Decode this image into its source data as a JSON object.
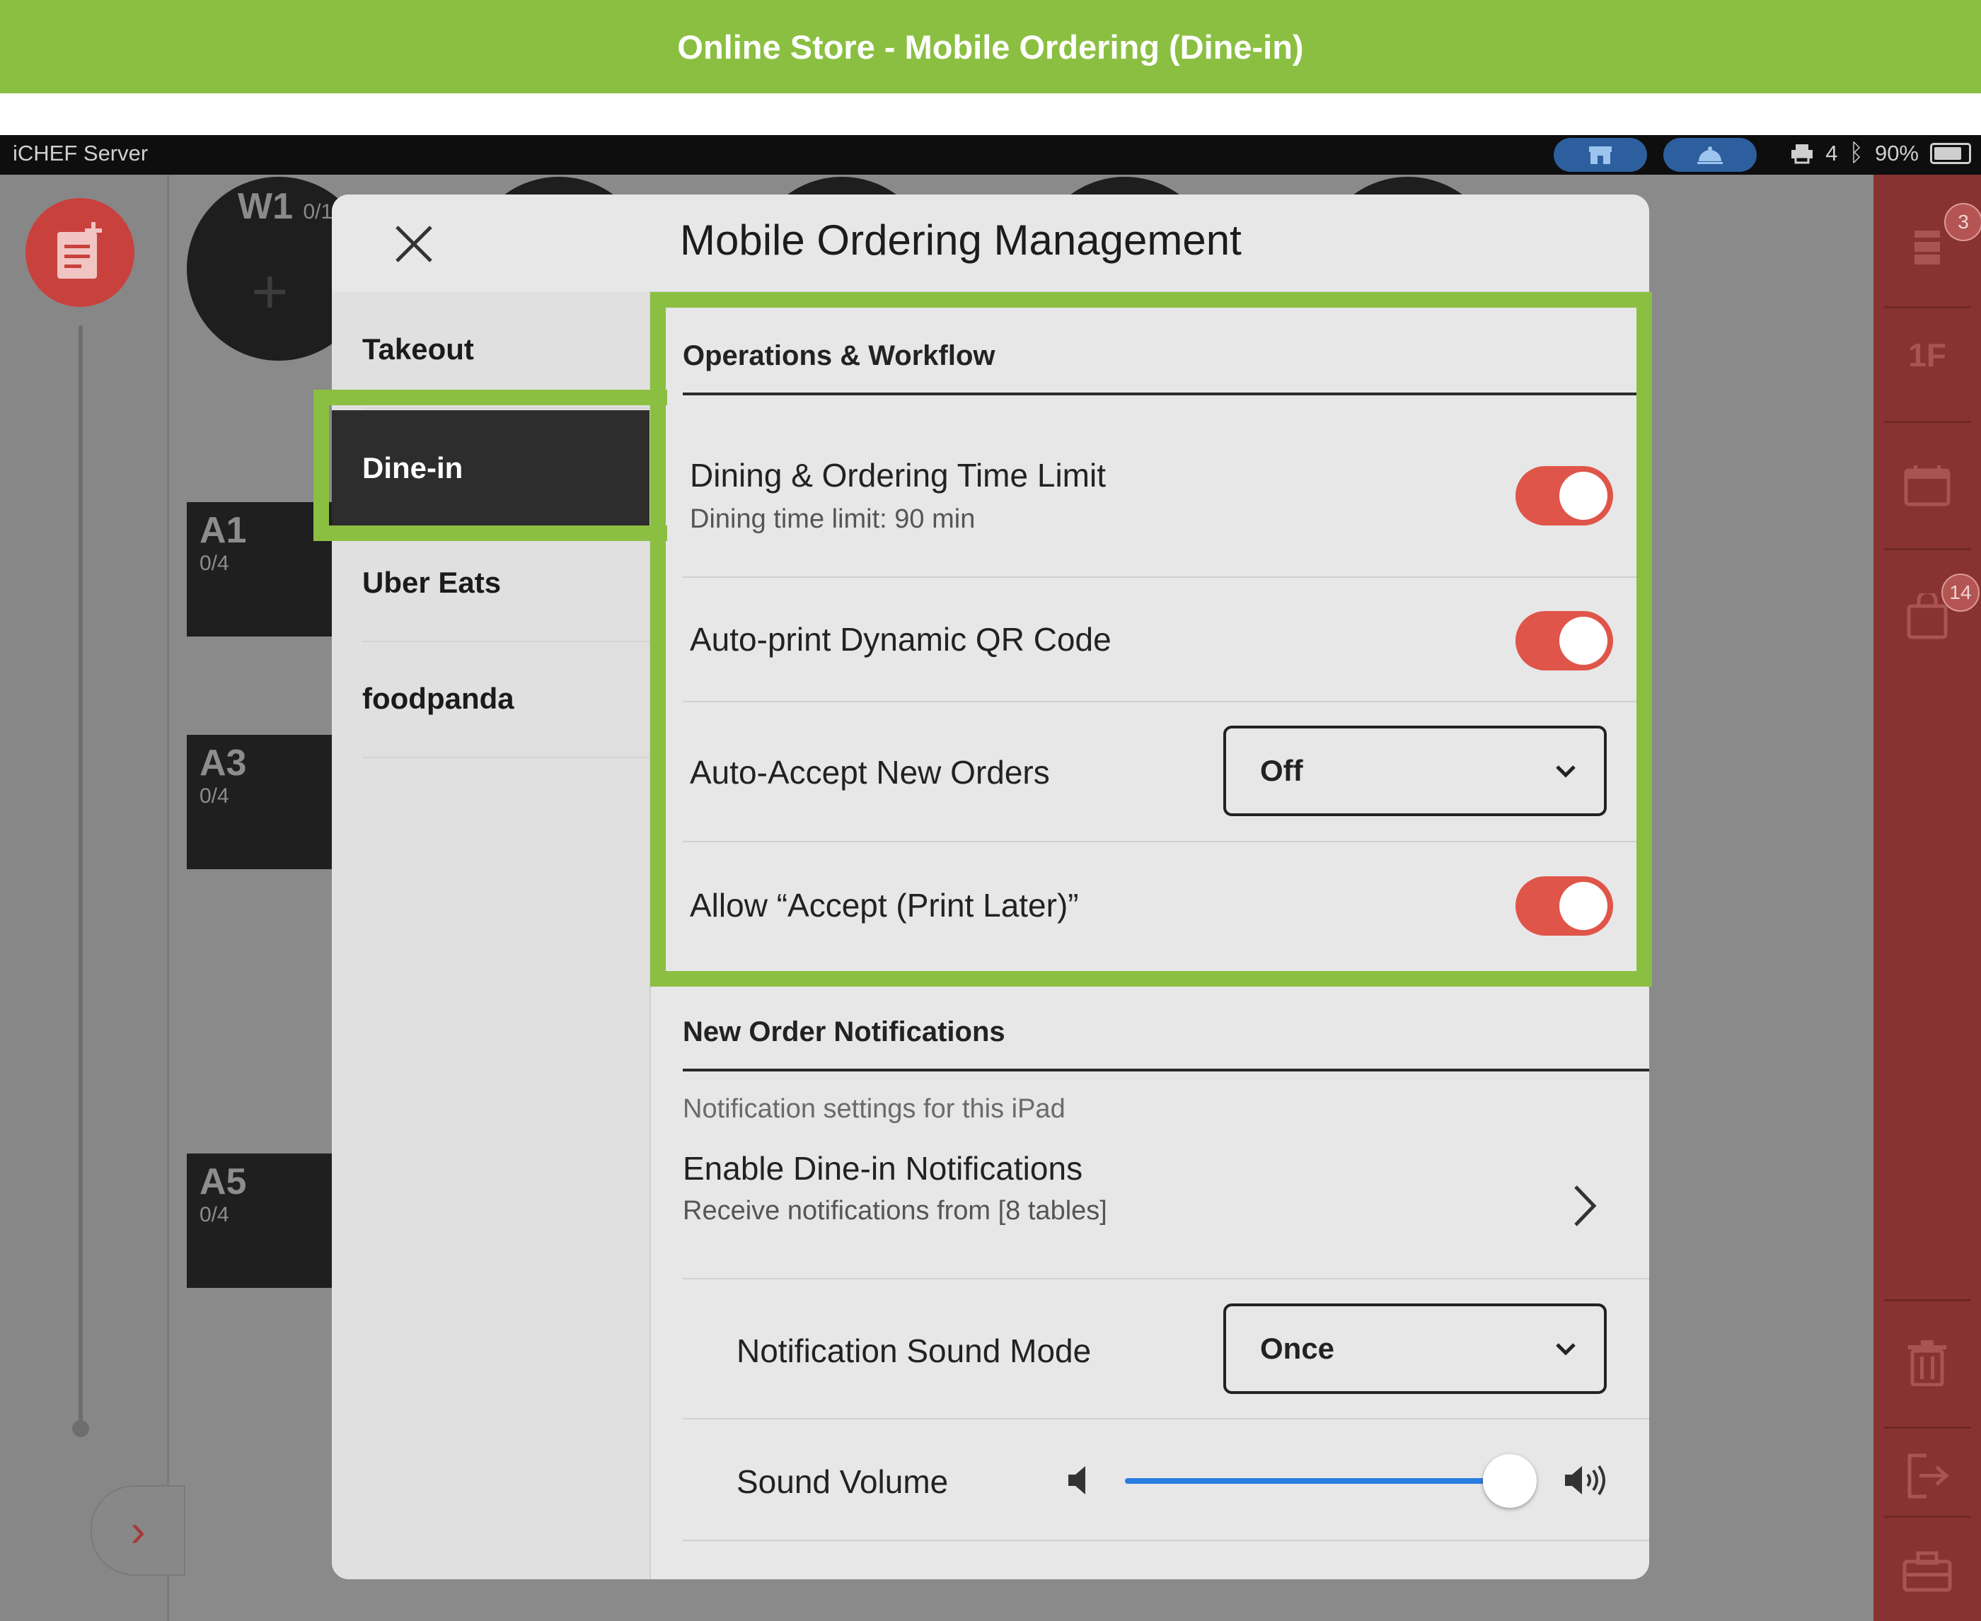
{
  "banner": {
    "title": "Online Store - Mobile Ordering (Dine-in)"
  },
  "status_bar": {
    "app_name": "iCHEF Server",
    "printer_count": "4",
    "battery": "90%"
  },
  "floor": {
    "w1": {
      "name": "W1",
      "capacity": "0/1"
    },
    "tables": [
      {
        "name": "A1",
        "capacity": "0/4"
      },
      {
        "name": "A3",
        "capacity": "0/4"
      },
      {
        "name": "A5",
        "capacity": "0/4"
      }
    ]
  },
  "right_bar": {
    "orders_badge": "3",
    "floor_label": "1F",
    "bag_badge": "14"
  },
  "modal": {
    "title": "Mobile Ordering Management",
    "sidebar": [
      "Takeout",
      "Dine-in",
      "Uber Eats",
      "foodpanda"
    ],
    "ops": {
      "heading": "Operations & Workflow",
      "time_limit": {
        "title": "Dining & Ordering Time Limit",
        "subtitle": "Dining time limit: 90 min",
        "enabled": true
      },
      "auto_print": {
        "title": "Auto-print Dynamic QR Code",
        "enabled": true
      },
      "auto_accept": {
        "title": "Auto-Accept New Orders",
        "value": "Off"
      },
      "print_later": {
        "title": "Allow “Accept (Print Later)”",
        "enabled": true
      }
    },
    "notifications": {
      "heading": "New Order Notifications",
      "note": "Notification settings for this iPad",
      "enable": {
        "title": "Enable Dine-in Notifications",
        "subtitle": "Receive notifications from [8 tables]"
      },
      "sound_mode": {
        "title": "Notification Sound Mode",
        "value": "Once"
      },
      "volume": {
        "title": "Sound Volume",
        "level": 1.0
      }
    }
  },
  "colors": {
    "accent_green": "#8bbf42",
    "toggle_on": "#e05549",
    "slider": "#2a7de1",
    "sidebar_active": "#2d2d2d"
  }
}
